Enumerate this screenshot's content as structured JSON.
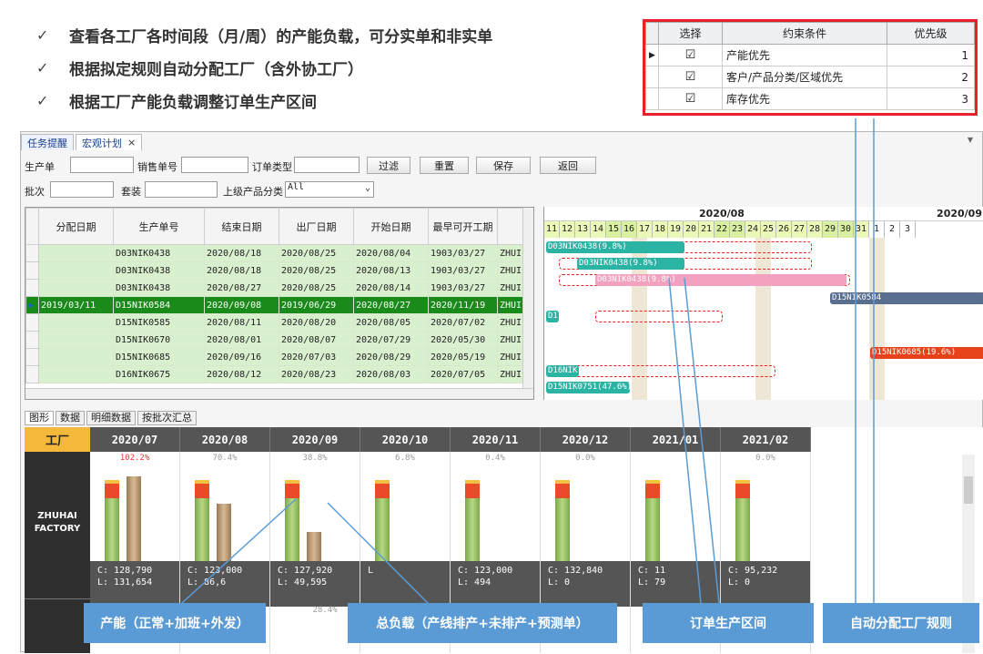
{
  "bullets": [
    {
      "check": "✓",
      "text": "查看各工厂各时间段（月/周）的产能负载，可分实单和非实单"
    },
    {
      "check": "✓",
      "text": "根据拟定规则自动分配工厂（含外协工厂）"
    },
    {
      "check": "✓",
      "text": "根据工厂产能负载调整订单生产区间"
    }
  ],
  "constraints": {
    "headers": [
      "选择",
      "约束条件",
      "优先级"
    ],
    "rows": [
      {
        "check": "☑",
        "name": "产能优先",
        "priority": "1"
      },
      {
        "check": "☑",
        "name": "客户/产品分类/区域优先",
        "priority": "2"
      },
      {
        "check": "☑",
        "name": "库存优先",
        "priority": "3"
      }
    ]
  },
  "tabs": {
    "reminder": "任务提醒",
    "plan": "宏观计划",
    "close": "×"
  },
  "filters": {
    "prod_order": "生产单",
    "sales_order": "销售单号",
    "order_type": "订单类型",
    "filter_btn": "过滤",
    "reset_btn": "重置",
    "save_btn": "保存",
    "back_btn": "返回",
    "batch": "批次",
    "set": "套装",
    "category": "上级产品分类",
    "category_value": "All"
  },
  "grid": {
    "headers": [
      "分配日期",
      "生产单号",
      "结束日期",
      "出厂日期",
      "开始日期",
      "最早可开工期",
      ""
    ],
    "rows": [
      [
        "",
        "D03NIK0438",
        "2020/08/18",
        "2020/08/25",
        "2020/08/04",
        "1903/03/27",
        "ZHUI"
      ],
      [
        "",
        "D03NIK0438",
        "2020/08/18",
        "2020/08/25",
        "2020/08/13",
        "1903/03/27",
        "ZHUI"
      ],
      [
        "",
        "D03NIK0438",
        "2020/08/27",
        "2020/08/25",
        "2020/08/14",
        "1903/03/27",
        "ZHUI"
      ],
      [
        "2019/03/11",
        "D15NIK0584",
        "2020/09/08",
        "2019/06/29",
        "2020/08/27",
        "2020/11/19",
        "ZHUI"
      ],
      [
        "",
        "D15NIK0585",
        "2020/08/11",
        "2020/08/20",
        "2020/08/05",
        "2020/07/02",
        "ZHUI"
      ],
      [
        "",
        "D15NIK0670",
        "2020/08/01",
        "2020/08/07",
        "2020/07/29",
        "2020/05/30",
        "ZHUI"
      ],
      [
        "",
        "D15NIK0685",
        "2020/09/16",
        "2020/07/03",
        "2020/08/29",
        "2020/05/19",
        "ZHUI"
      ],
      [
        "",
        "D16NIK0675",
        "2020/08/12",
        "2020/08/23",
        "2020/08/03",
        "2020/07/05",
        "ZHUI"
      ]
    ]
  },
  "gantt": {
    "month1": "2020/08",
    "month2": "2020/09",
    "days": [
      "11",
      "12",
      "13",
      "14",
      "15",
      "16",
      "17",
      "18",
      "19",
      "20",
      "21",
      "22",
      "23",
      "24",
      "25",
      "26",
      "27",
      "28",
      "29",
      "30",
      "31",
      "1",
      "2",
      "3"
    ],
    "bars": {
      "b1": "D03NIK0438(9.8%)",
      "b2": "D03NIK0438(9.8%)",
      "b3": "D03NIK0438(9.8%)",
      "b4": "D15NIK0584",
      "b5": "D1",
      "b6": "D15NIK0685(19.6%)",
      "b7": "D16NIK",
      "b8": "D15NIK0751(47.6%)"
    }
  },
  "bottom_tabs": [
    "图形",
    "数据",
    "明细数据",
    "按批次汇总"
  ],
  "chart": {
    "factory_header": "工厂",
    "factory": "ZHUHAI FACTORY",
    "months": [
      {
        "label": "2020/07",
        "pct": "102.2%",
        "c": "C: 128,790",
        "l": "L: 131,654",
        "load": 1.0
      },
      {
        "label": "2020/08",
        "pct": "70.4%",
        "c": "C: 123,000",
        "l": "L: 86,6",
        "load": 0.7
      },
      {
        "label": "2020/09",
        "pct": "38.8%",
        "c": "C: 127,920",
        "l": "L: 49,595",
        "load": 0.39
      },
      {
        "label": "2020/10",
        "pct": "6.8%",
        "c": "",
        "l": "L",
        "load": 0.07
      },
      {
        "label": "2020/11",
        "pct": "0.4%",
        "c": "C: 123,000",
        "l": "L: 494",
        "load": 0.01
      },
      {
        "label": "2020/12",
        "pct": "0.0%",
        "c": "C: 132,840",
        "l": "L: 0",
        "load": 0
      },
      {
        "label": "2021/01",
        "pct": "",
        "c": "C: 11",
        "l": "L: 79",
        "load": 0
      },
      {
        "label": "2021/02",
        "pct": "0.0%",
        "c": "C: 95,232",
        "l": "L: 0",
        "load": 0
      }
    ],
    "next_row_pct": "28.4%"
  },
  "callouts": {
    "capacity": "产能（正常+加班+外发）",
    "total_load": "总负载（产线排产+未排产+预测单）",
    "interval": "订单生产区间",
    "rule": "自动分配工厂规则"
  }
}
